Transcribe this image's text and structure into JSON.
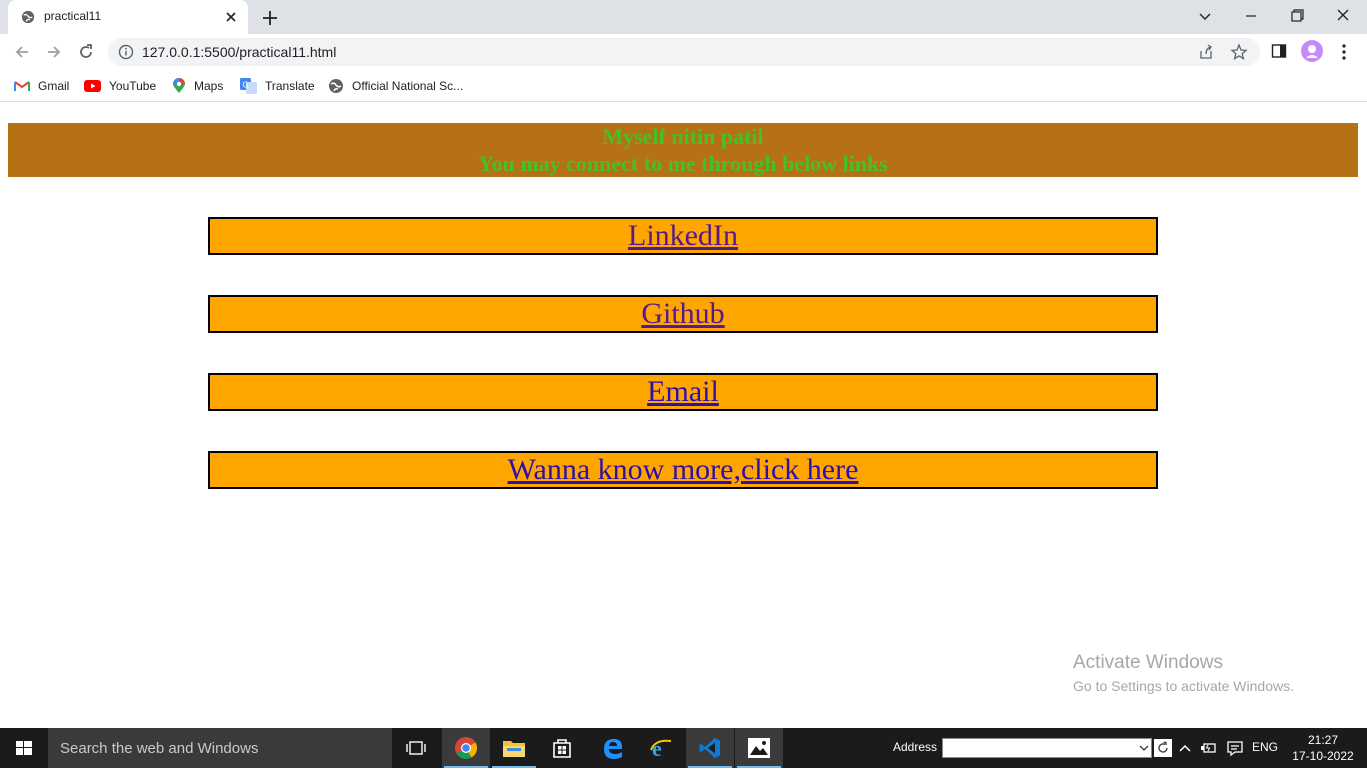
{
  "browser": {
    "tab_title": "practical11",
    "url": "127.0.0.1:5500/practical11.html",
    "bookmarks": [
      {
        "label": "Gmail",
        "icon": "gmail-icon"
      },
      {
        "label": "YouTube",
        "icon": "youtube-icon"
      },
      {
        "label": "Maps",
        "icon": "maps-icon"
      },
      {
        "label": "Translate",
        "icon": "translate-icon"
      },
      {
        "label": "Official National Sc...",
        "icon": "globe-icon"
      }
    ]
  },
  "page": {
    "header_line1": "Myself nitin patil",
    "header_line2": "You may connect to me through below links",
    "links": [
      {
        "label": "LinkedIn"
      },
      {
        "label": "Github"
      },
      {
        "label": "Email"
      },
      {
        "label": "Wanna know more,click here"
      }
    ],
    "colors": {
      "header_bg": "#b57114",
      "header_text": "#44c12a",
      "link_box_bg": "#ffa500",
      "link_text": "#2e0fa8",
      "visited_link_text": "#551a8b"
    }
  },
  "watermark": {
    "line1": "Activate Windows",
    "line2": "Go to Settings to activate Windows."
  },
  "taskbar": {
    "search_placeholder": "Search the web and Windows",
    "address_label": "Address",
    "language": "ENG",
    "time": "21:27",
    "date": "17-10-2022"
  }
}
